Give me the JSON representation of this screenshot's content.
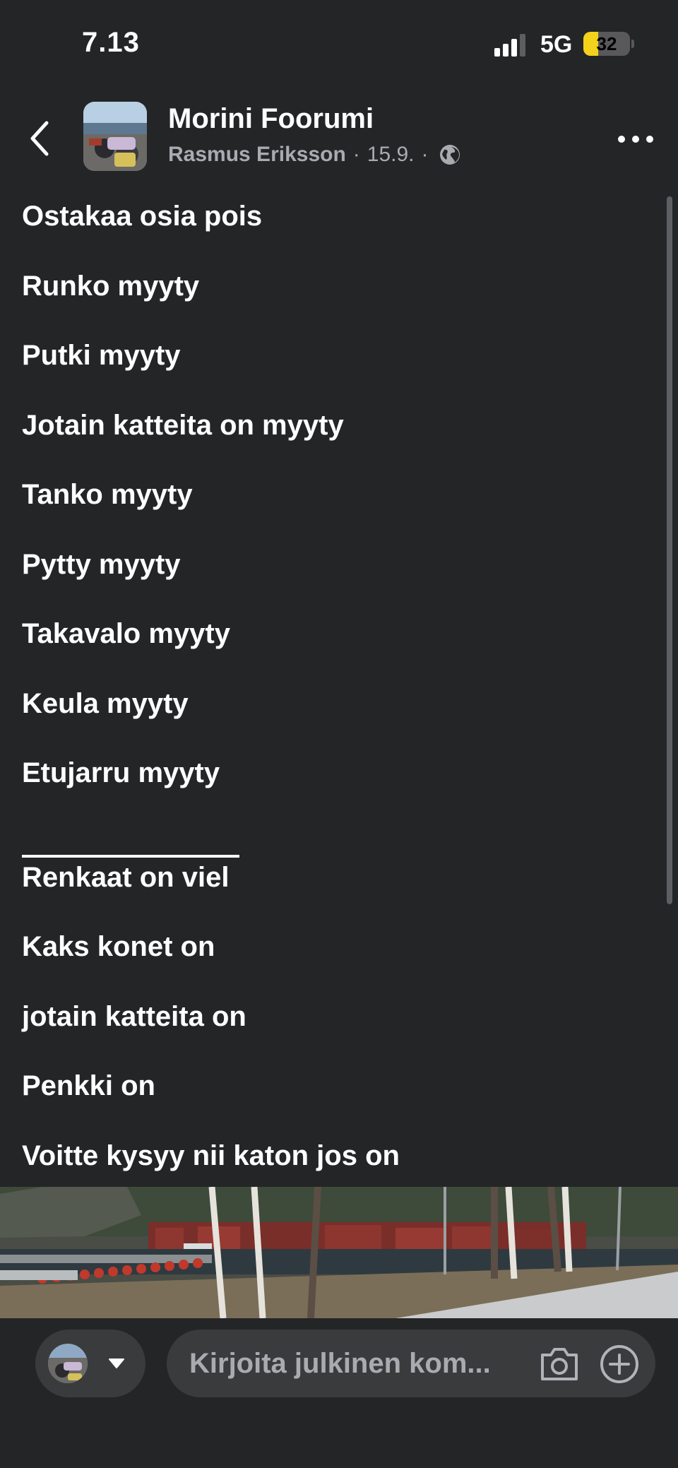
{
  "status_bar": {
    "time": "7.13",
    "network": "5G",
    "battery": "32",
    "battery_level": 0.32
  },
  "header": {
    "group_name": "Morini Foorumi",
    "author": "Rasmus Eriksson",
    "date": "15.9.",
    "separator": "·",
    "back_icon": "chevron-left-icon",
    "globe_icon": "globe-icon",
    "more_icon": "more-horizontal-icon"
  },
  "post": {
    "lines": [
      "Ostakaa osia pois",
      "Runko myyty",
      "Putki myyty",
      "Jotain katteita on myyty",
      "Tanko myyty",
      "Pytty myyty",
      "Takavalo myyty",
      "Keula myyty",
      "Etujarru myyty",
      "Renkaat on viel",
      "Kaks konet on",
      "jotain katteita on",
      "Penkki on",
      "Voitte kysyy nii katon jos on"
    ]
  },
  "composer": {
    "placeholder": "Kirjoita julkinen kom...",
    "camera_icon": "camera-icon",
    "add_icon": "plus-circle-icon",
    "caret_icon": "caret-down-icon"
  },
  "colors": {
    "background": "#242527",
    "field": "#3a3b3c",
    "muted_text": "#a8abb0",
    "battery_accent": "#f2d21a"
  }
}
